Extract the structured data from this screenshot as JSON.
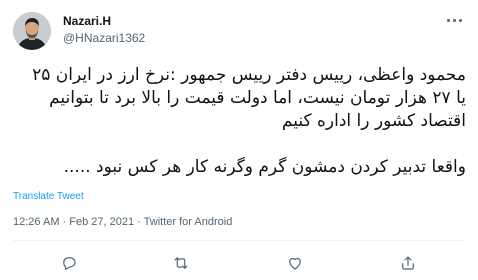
{
  "user": {
    "name": "Nazari.H",
    "handle": "@HNazari1362"
  },
  "tweet": {
    "text": "محمود واعظی، رییس دفتر رییس جمهور :نرخ ارز در ایران ۲۵\nیا ۲۷ هزار تومان نیست، اما دولت قیمت را بالا برد تا بتوانیم\nاقتصاد کشور را اداره کنیم\n\nواقعا تدبیر کردن دمشون گرم وگرنه کار هر کس نبود .....",
    "translate_label": "Translate Tweet",
    "timestamp": "12:26 AM · Feb 27, 2021 · Twitter for Android"
  },
  "actions": [
    {
      "name": "reply-icon"
    },
    {
      "name": "retweet-icon"
    },
    {
      "name": "like-icon"
    },
    {
      "name": "share-icon"
    }
  ],
  "colors": {
    "link": "#1d9bf0",
    "secondary_text": "#536471",
    "primary_text": "#0f1419"
  }
}
